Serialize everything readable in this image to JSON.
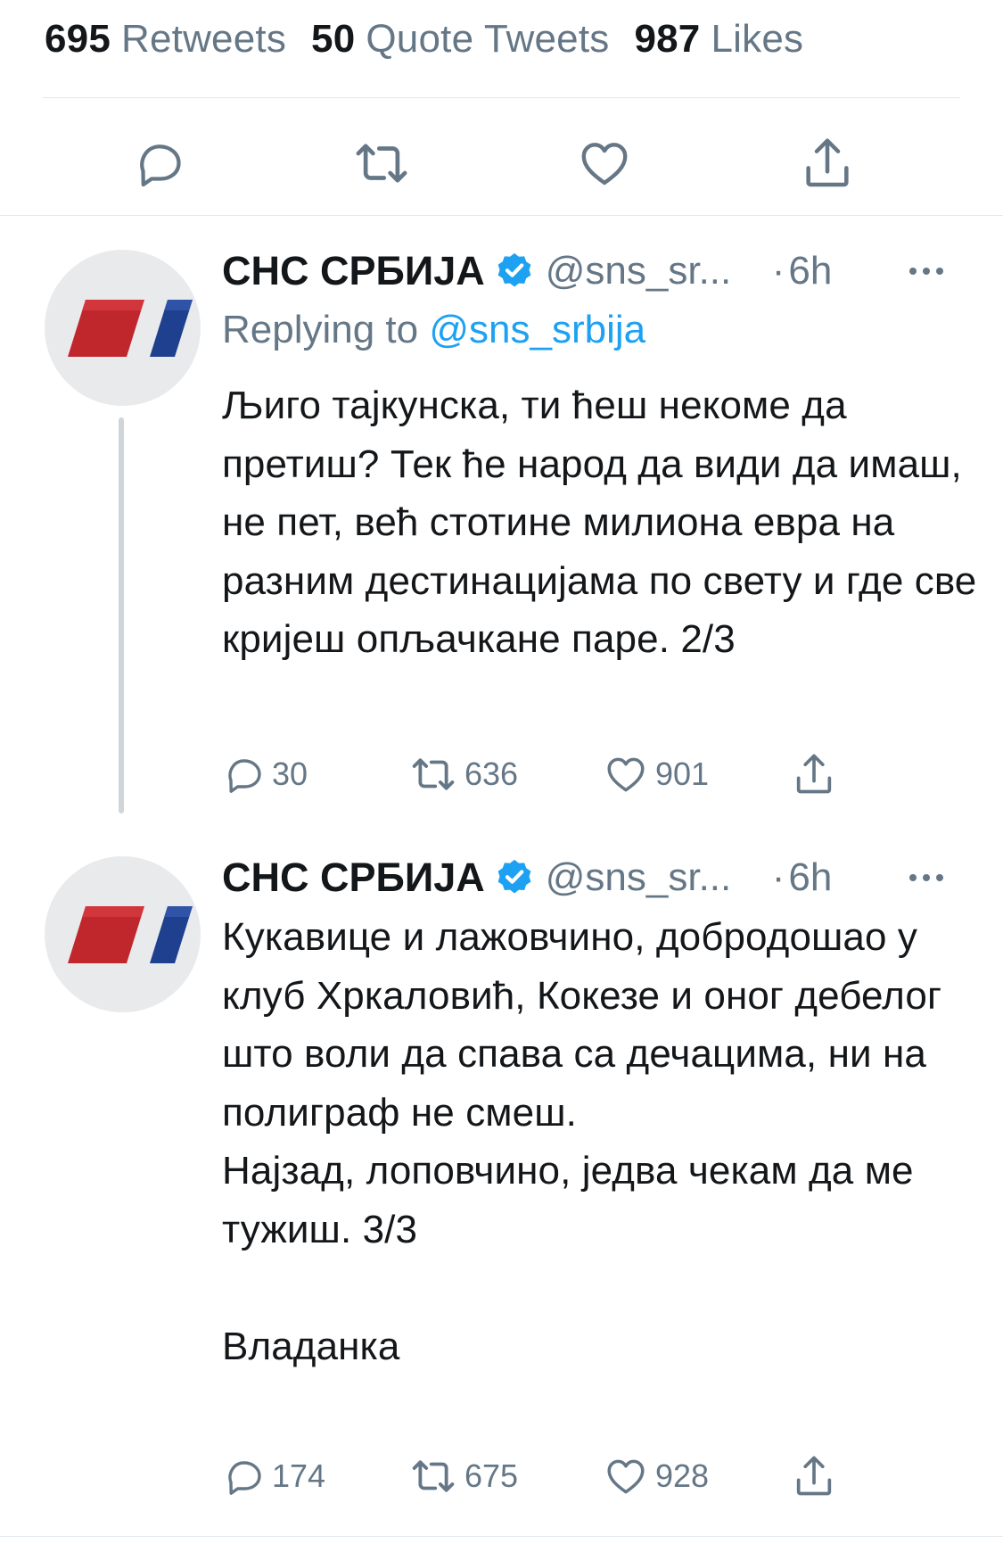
{
  "stats": {
    "retweets_count": "695",
    "retweets_label": "Retweets",
    "quotes_count": "50",
    "quotes_label": "Quote Tweets",
    "likes_count": "987",
    "likes_label": "Likes"
  },
  "colors": {
    "text": "#14171a",
    "secondary": "#657786",
    "link": "#1da1f2",
    "divider": "#e1e8ed",
    "verified": "#1da1f2",
    "logo_red": "#c0272d",
    "logo_blue": "#1f3f8f"
  },
  "tweets": [
    {
      "name": "СНС СРБИЈА",
      "handle": "@sns_sr...",
      "dot": "·",
      "time": "6h",
      "replying_prefix": "Replying to",
      "replying_handle": "@sns_srbija",
      "text": "Љиго тајкунска, ти ћеш некоме да претиш? Тек ће народ да види да имаш, не пет, већ стотине милиона евра на разним дестинацијама по свету и где све кријеш опљачкане паре. 2/3",
      "replies": "30",
      "retweets": "636",
      "likes": "901",
      "icons": [
        "reply-icon",
        "retweet-icon",
        "like-icon",
        "share-icon"
      ]
    },
    {
      "name": "СНС СРБИЈА",
      "handle": "@sns_sr...",
      "dot": "·",
      "time": "6h",
      "text": "Кукавице и лажовчино, добродошао у клуб Хркаловић, Кокезе и оног дебелог што воли да спава са дечацима, ни на полиграф не смеш.\nНајзад, лоповчино, једва чекам да ме тужиш. 3/3\n\nВладанка",
      "replies": "174",
      "retweets": "675",
      "likes": "928",
      "icons": [
        "reply-icon",
        "retweet-icon",
        "like-icon",
        "share-icon"
      ]
    }
  ]
}
